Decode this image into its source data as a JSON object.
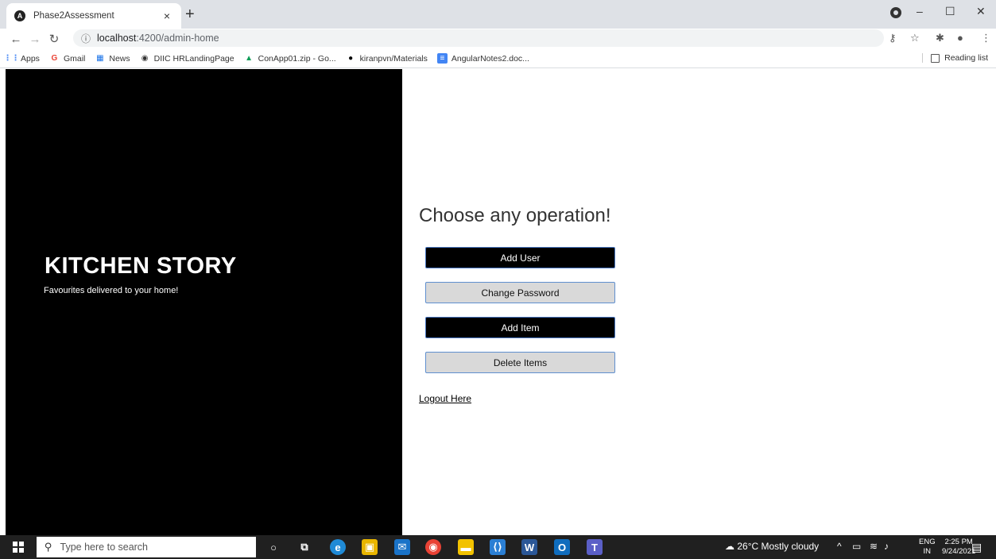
{
  "browser": {
    "tab_title": "Phase2Assessment",
    "tab_close": "×",
    "new_tab": "+",
    "url_host": "localhost",
    "url_path": ":4200/admin-home",
    "minimize": "–",
    "maximize": "☐",
    "close": "✕",
    "bookmarks": [
      {
        "label": "Apps",
        "icon": "apps-grid-icon",
        "color": "#4285f4"
      },
      {
        "label": "Gmail",
        "icon": "google-icon",
        "color": "#ea4335"
      },
      {
        "label": "News",
        "icon": "news-icon",
        "color": "#1a73e8"
      },
      {
        "label": "DIIC HRLandingPage",
        "icon": "globe-icon",
        "color": "#333333"
      },
      {
        "label": "ConApp01.zip - Go...",
        "icon": "drive-icon",
        "color": "#0f9d58"
      },
      {
        "label": "kiranpvn/Materials",
        "icon": "github-icon",
        "color": "#000000"
      },
      {
        "label": "AngularNotes2.doc...",
        "icon": "docs-icon",
        "color": "#4285f4"
      }
    ],
    "reading_list": "Reading list"
  },
  "page": {
    "brand_title": "KITCHEN STORY",
    "brand_tagline": "Favourites delivered to your home!",
    "heading": "Choose any operation!",
    "buttons": {
      "add_user": "Add User",
      "change_password": "Change Password",
      "add_item": "Add Item",
      "delete_items": "Delete Items"
    },
    "logout": "Logout Here"
  },
  "taskbar": {
    "search_placeholder": "Type here to search",
    "weather": "26°C  Mostly cloudy",
    "lang_top": "ENG",
    "lang_bottom": "IN",
    "time": "2:25 PM",
    "date": "9/24/2021"
  }
}
